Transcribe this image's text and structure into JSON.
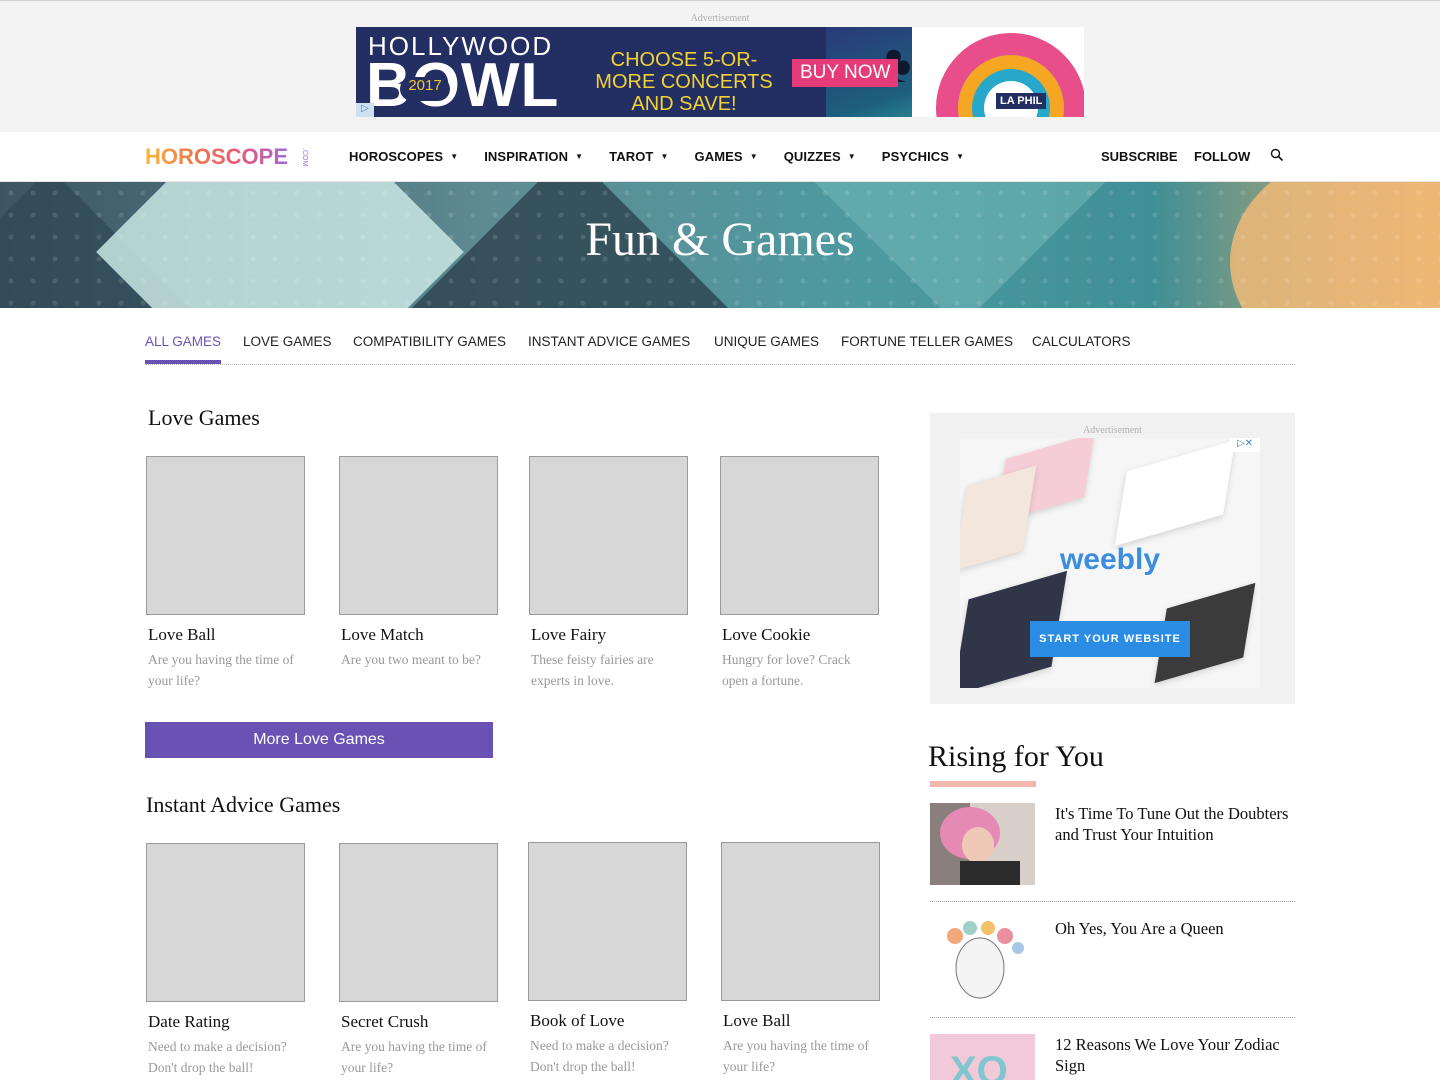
{
  "top_ad": {
    "label": "Advertisement",
    "line1": "HOLLYWOOD",
    "line2": "BOWL",
    "year": "2017",
    "offer": "CHOOSE 5-OR-MORE CONCERTS AND SAVE!",
    "cta": "BUY NOW",
    "brand": "LA PHIL"
  },
  "nav": {
    "logo": "HOROSCOPE",
    "logo_suffix": ".COM",
    "items": [
      "HOROSCOPES",
      "INSPIRATION",
      "TAROT",
      "GAMES",
      "QUIZZES",
      "PSYCHICS"
    ],
    "subscribe": "SUBSCRIBE",
    "follow": "FOLLOW",
    "search_icon": "search-icon"
  },
  "hero": {
    "title": "Fun & Games"
  },
  "tabs": [
    "ALL GAMES",
    "LOVE GAMES",
    "COMPATIBILITY GAMES",
    "INSTANT ADVICE GAMES",
    "UNIQUE GAMES",
    "FORTUNE TELLER GAMES",
    "CALCULATORS"
  ],
  "love_games": {
    "title": "Love Games",
    "cards": [
      {
        "title": "Love Ball",
        "desc": "Are you having the time of your life?"
      },
      {
        "title": "Love Match",
        "desc": "Are you two meant to be?"
      },
      {
        "title": "Love Fairy",
        "desc": "These feisty fairies are experts in love."
      },
      {
        "title": "Love Cookie",
        "desc": "Hungry for love? Crack open a fortune."
      }
    ],
    "more_button": "More Love Games"
  },
  "advice_games": {
    "title": "Instant Advice Games",
    "cards": [
      {
        "title": "Date Rating",
        "desc": "Need to make a decision? Don't drop the ball!"
      },
      {
        "title": "Secret Crush",
        "desc": "Are you having the time of your life?"
      },
      {
        "title": "Book of Love",
        "desc": "Need to make a decision? Don't drop the ball!"
      },
      {
        "title": "Love Ball",
        "desc": "Are you having the time of your life?"
      }
    ]
  },
  "side_ad": {
    "label": "Advertisement",
    "brand": "weebly",
    "cta": "START YOUR WEBSITE"
  },
  "rising": {
    "title": "Rising for You",
    "items": [
      {
        "title": "It's Time To Tune Out the Doubters and Trust Your Intuition"
      },
      {
        "title": "Oh Yes, You Are a Queen"
      },
      {
        "title": "12 Reasons We Love Your Zodiac Sign"
      }
    ]
  },
  "colors": {
    "accent": "#6a52b5",
    "rising_bar": "#f2b6ad",
    "placeholder": "#d7d7d7"
  }
}
